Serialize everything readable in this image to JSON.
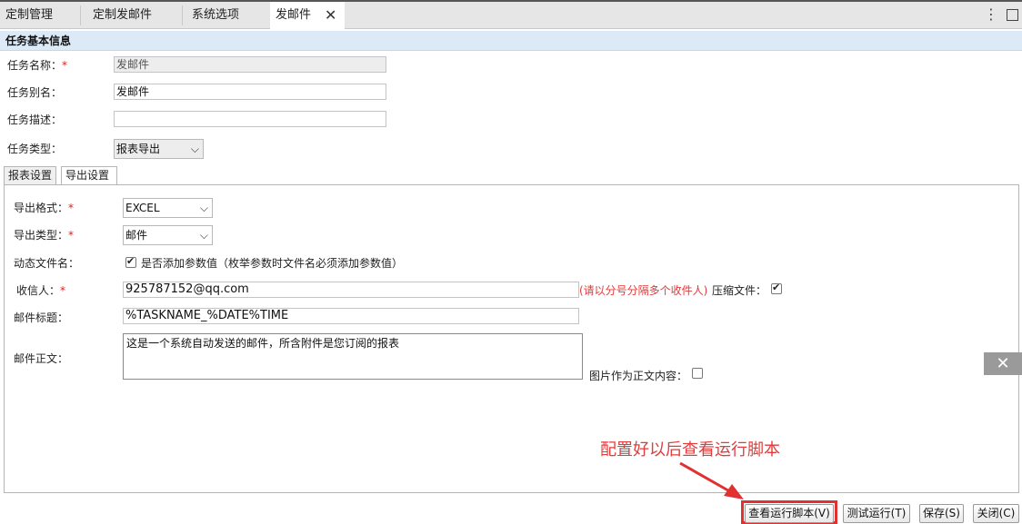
{
  "tabs": [
    {
      "label": "定制管理"
    },
    {
      "label": "定制发邮件"
    },
    {
      "label": "系统选项"
    },
    {
      "label": "发邮件",
      "active": true
    }
  ],
  "section": {
    "title": "任务基本信息"
  },
  "basic": {
    "name_label": "任务名称：",
    "name_value": "发邮件",
    "alias_label": "任务别名：",
    "alias_value": "发邮件",
    "desc_label": "任务描述：",
    "desc_value": "",
    "type_label": "任务类型：",
    "type_value": "报表导出"
  },
  "subtabs": [
    {
      "label": "报表设置"
    },
    {
      "label": "导出设置",
      "active": true
    }
  ],
  "export": {
    "format_label": "导出格式：",
    "format_value": "EXCEL",
    "type_label": "导出类型：",
    "type_value": "邮件",
    "dynamic_label": "动态文件名：",
    "dynamic_checkbox_text": "是否添加参数值（枚举参数时文件名必须添加参数值）",
    "dynamic_checked": true,
    "recipient_label": "收信人：",
    "recipient_value": "925787152@qq.com",
    "recipient_hint": "(请以分号分隔多个收件人)",
    "compress_label": "压缩文件：",
    "compress_checked": true,
    "subject_label": "邮件标题：",
    "subject_value": "%TASKNAME_%DATE%TIME",
    "body_label": "邮件正文：",
    "body_value": "这是一个系统自动发送的邮件，所含附件是您订阅的报表",
    "image_body_label": "图片作为正文内容：",
    "image_body_checked": false
  },
  "required_mark": "*",
  "annotation": "配置好以后查看运行脚本",
  "buttons": {
    "view_script": "查看运行脚本(V)",
    "test_run": "测试运行(T)",
    "save": "保存(S)",
    "close": "关闭(C)"
  },
  "colors": {
    "header_bg": "#dce9f7",
    "required": "#e02020",
    "annotation": "#e23b3b",
    "highlight": "#e23030"
  }
}
